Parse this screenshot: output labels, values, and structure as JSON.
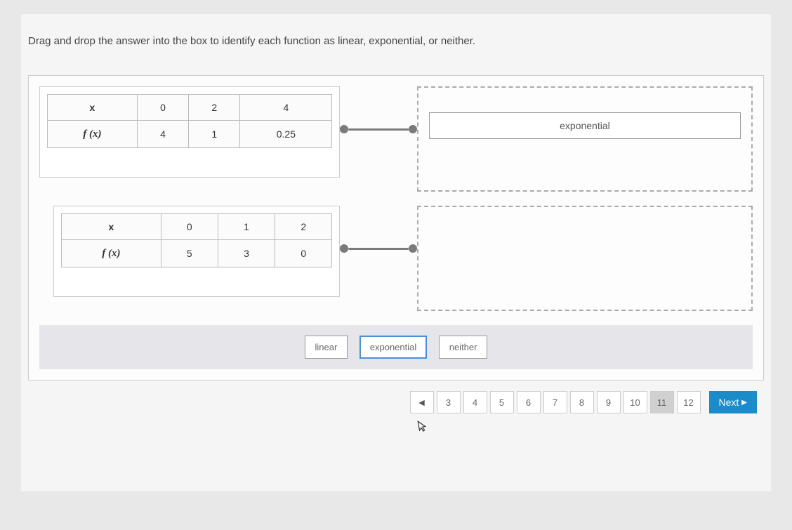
{
  "instruction": "Drag and drop the answer into the box to identify each function as linear, exponential, or neither.",
  "table1": {
    "row_x_label": "x",
    "row_fx_label": "f (x)",
    "x": [
      "0",
      "2",
      "4"
    ],
    "fx": [
      "4",
      "1",
      "0.25"
    ]
  },
  "drop1": {
    "answer": "exponential"
  },
  "table2": {
    "row_x_label": "x",
    "row_fx_label": "f (x)",
    "x": [
      "0",
      "1",
      "2"
    ],
    "fx": [
      "5",
      "3",
      "0"
    ]
  },
  "drop2": {
    "answer": ""
  },
  "choices": {
    "linear": "linear",
    "exponential": "exponential",
    "neither": "neither"
  },
  "pagination": {
    "prev_symbol": "◀",
    "pages": [
      "3",
      "4",
      "5",
      "6",
      "7",
      "8",
      "9",
      "10",
      "11",
      "12"
    ],
    "current": "11",
    "next_label": "Next",
    "next_symbol": "▶"
  }
}
